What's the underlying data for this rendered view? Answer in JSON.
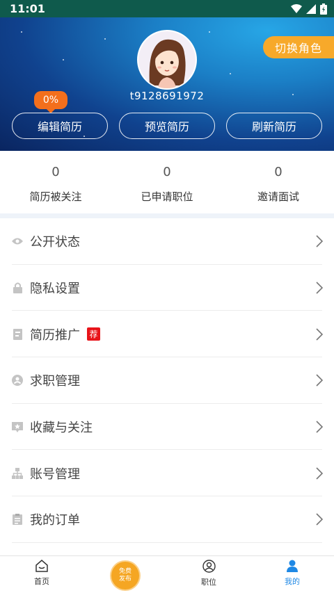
{
  "status_bar": {
    "time": "11:01"
  },
  "header": {
    "switch_role": "切换角色",
    "username": "t9128691972",
    "resume_progress": "0%",
    "buttons": {
      "edit": "编辑简历",
      "preview": "预览简历",
      "refresh": "刷新简历"
    }
  },
  "stats": [
    {
      "value": "0",
      "label": "简历被关注"
    },
    {
      "value": "0",
      "label": "已申请职位"
    },
    {
      "value": "0",
      "label": "邀请面试"
    }
  ],
  "menu": [
    {
      "label": "公开状态",
      "icon": "eye-icon"
    },
    {
      "label": "隐私设置",
      "icon": "lock-icon"
    },
    {
      "label": "简历推广",
      "icon": "resume-promote-icon",
      "badge": "荐"
    },
    {
      "label": "求职管理",
      "icon": "job-search-icon"
    },
    {
      "label": "收藏与关注",
      "icon": "bookmark-star-icon"
    },
    {
      "label": "账号管理",
      "icon": "account-tree-icon"
    },
    {
      "label": "我的订单",
      "icon": "order-clipboard-icon"
    }
  ],
  "bottom_nav": {
    "home": "首页",
    "publish_line1": "免费",
    "publish_line2": "发布",
    "jobs": "职位",
    "mine": "我的"
  },
  "colors": {
    "accent": "#1e88e5",
    "orange": "#f7a92a",
    "badge_red": "#e8141a",
    "status_bar": "#0f5a4c"
  }
}
